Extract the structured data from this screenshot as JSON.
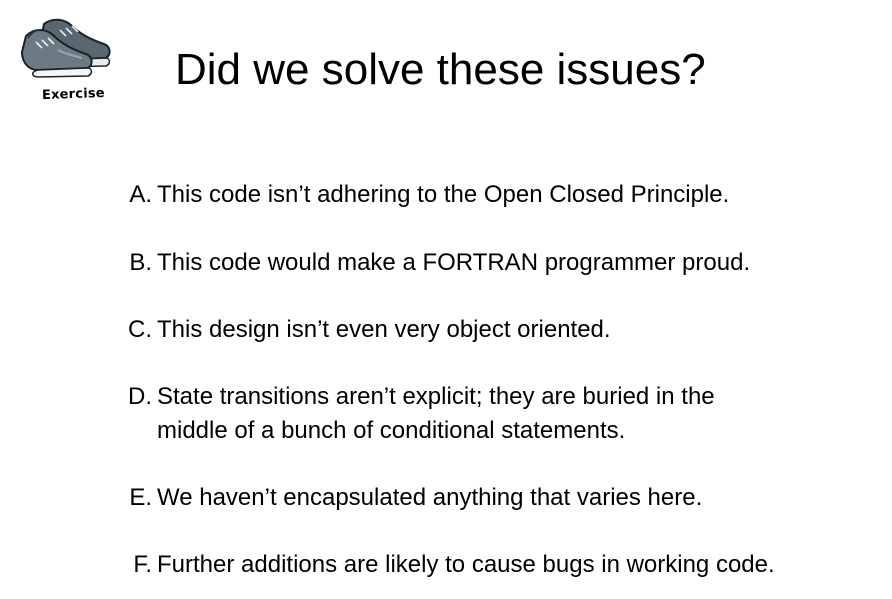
{
  "logo": {
    "label": "Exercise",
    "icon": "sneakers-icon"
  },
  "title": "Did we solve these issues?",
  "items": [
    {
      "letter": "A.",
      "text": "This code isn’t adhering to the Open Closed Principle."
    },
    {
      "letter": "B.",
      "text": "This code would make a FORTRAN programmer proud."
    },
    {
      "letter": "C.",
      "text": "This design isn’t even very object oriented."
    },
    {
      "letter": "D.",
      "text": "State transitions aren’t explicit; they are buried in the\nmiddle of a bunch of conditional statements."
    },
    {
      "letter": "E.",
      "text": "We haven’t encapsulated anything that varies here."
    },
    {
      "letter": "F.",
      "text": "Further additions are likely to cause bugs in working code."
    }
  ]
}
